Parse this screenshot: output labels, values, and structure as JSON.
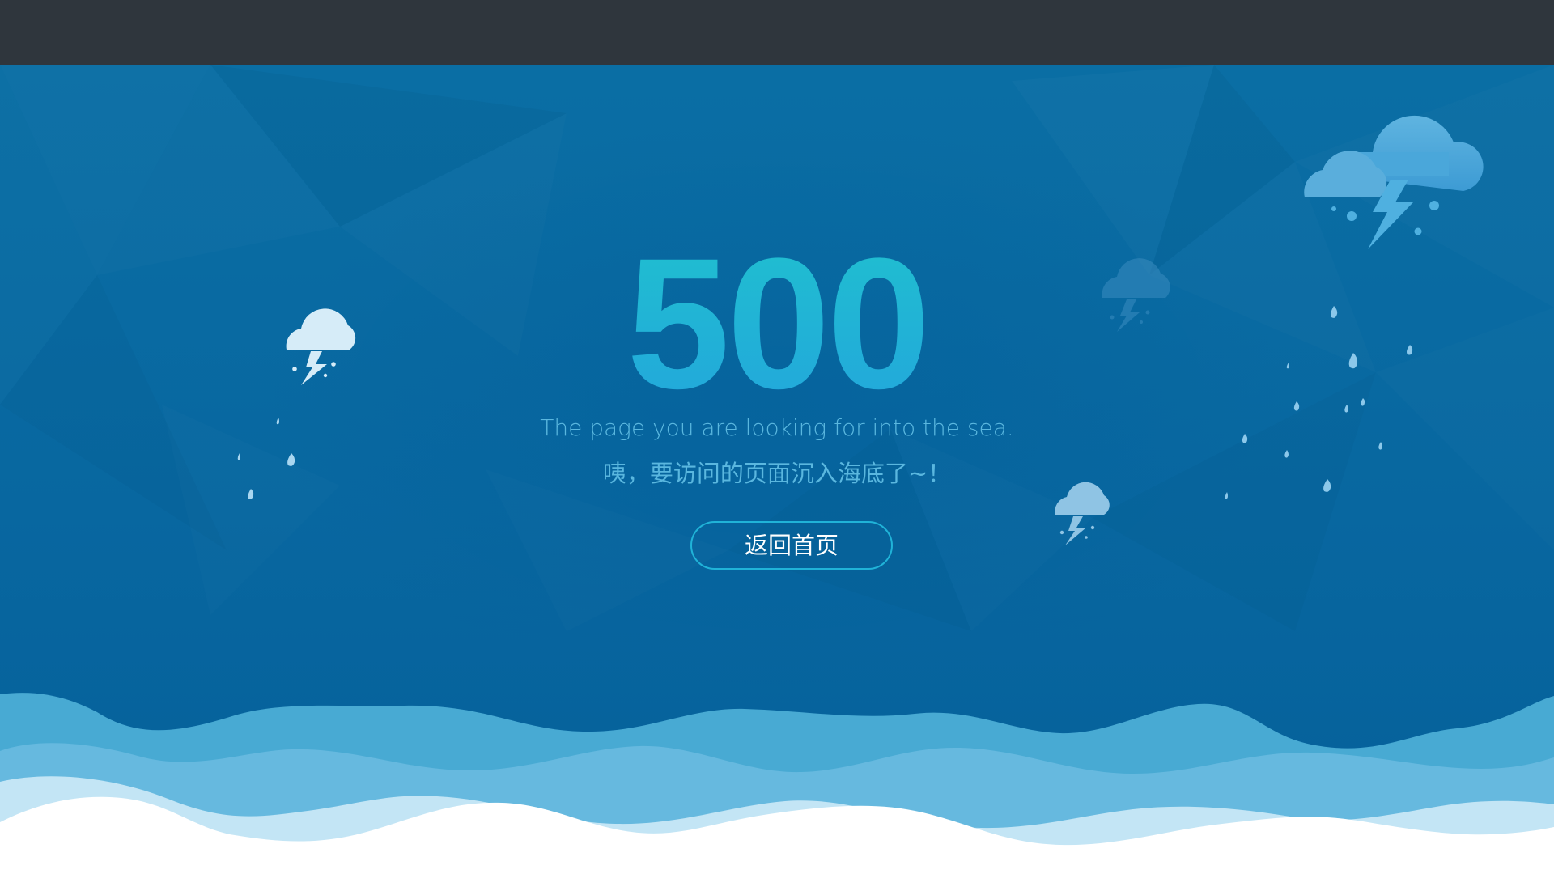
{
  "error": {
    "code": "500",
    "message_en": "The page you are looking for into the sea.",
    "message_cn": "咦，要访问的页面沉入海底了~！"
  },
  "actions": {
    "home_label": "返回首页"
  },
  "colors": {
    "topbar": "#2f363d",
    "sea": "#0a6fa3",
    "code_gradient_start": "#20c0cf",
    "code_gradient_end": "#22a6dc",
    "message": "#5ab7df",
    "button_border": "#20b3d8",
    "wave_dark": "#48aad3",
    "wave_mid": "#66b9df",
    "wave_light": "#c3e5f5",
    "wave_white": "#ffffff"
  },
  "icons": {
    "cloud_large": "thunder-cloud-icon",
    "cloud_small": "thunder-cloud-icon",
    "raindrop": "raindrop-icon"
  }
}
